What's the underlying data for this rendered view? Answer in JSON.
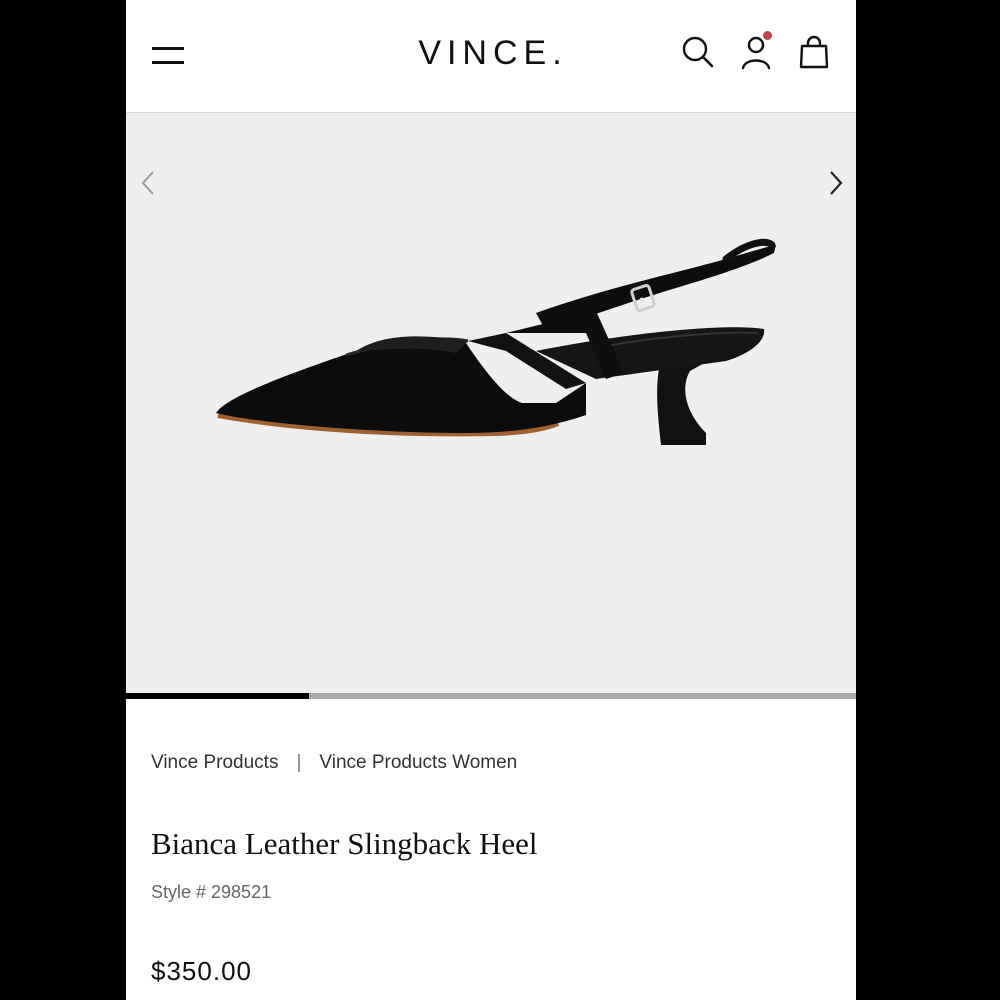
{
  "header": {
    "logo": "VINCE.",
    "icons": {
      "menu": "menu-icon",
      "search": "search-icon",
      "account": "account-icon",
      "bag": "bag-icon"
    },
    "notification_color": "#c0444c"
  },
  "carousel": {
    "icons": {
      "prev": "chevron-left-icon",
      "next": "chevron-right-icon"
    },
    "progress_fraction": 0.25,
    "progress_color": "#000000",
    "track_color": "#a9a9a9"
  },
  "breadcrumb": {
    "items": [
      "Vince Products",
      "Vince Products Women"
    ],
    "separator": "|"
  },
  "product": {
    "title": "Bianca Leather Slingback Heel",
    "style": "Style # 298521",
    "price": "$350.00"
  }
}
